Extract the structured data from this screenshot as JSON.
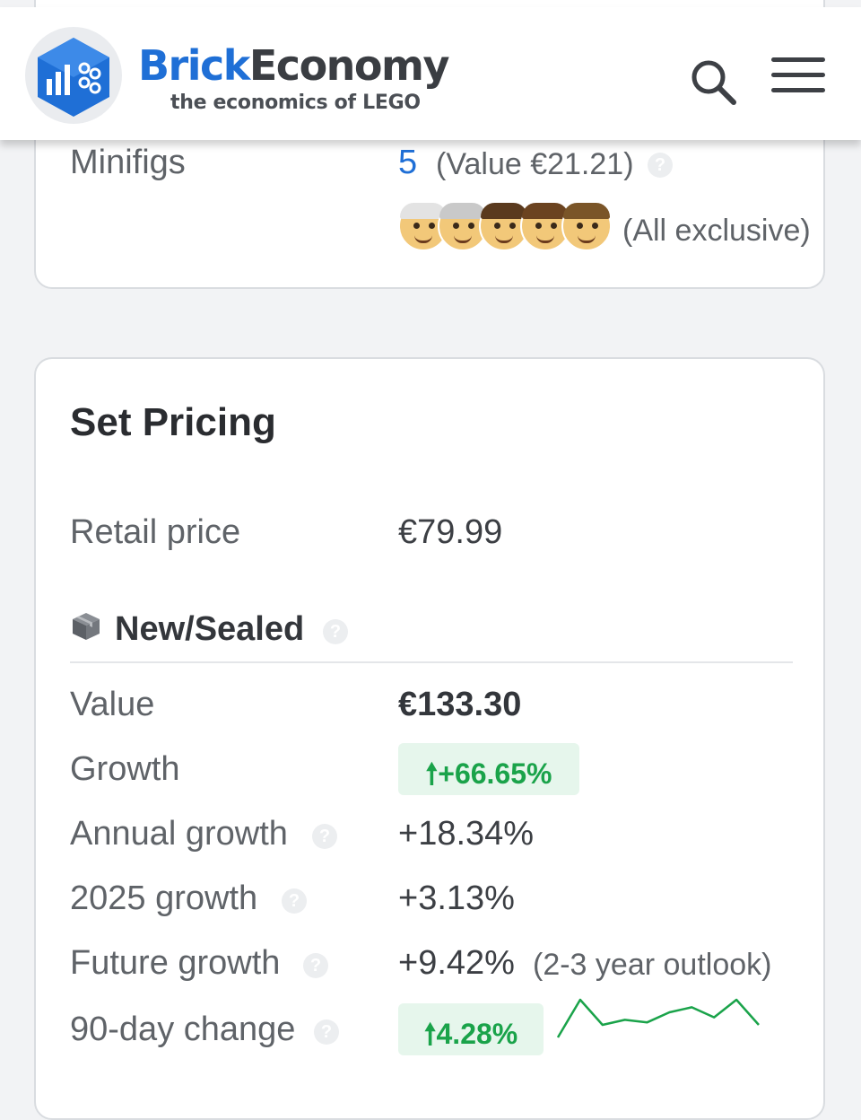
{
  "header": {
    "brand_part1": "Brick",
    "brand_part2": "Economy",
    "tagline": "the economics of LEGO",
    "search_icon": "search-icon",
    "menu_icon": "hamburger-menu-icon",
    "brand_color": "#1f6fd6"
  },
  "minifigs": {
    "label": "Minifigs",
    "count": "5",
    "value_text": "(Value €21.21)",
    "exclusive_text": "(All exclusive)",
    "faces": [
      "minifig-1",
      "minifig-2",
      "minifig-3",
      "minifig-4",
      "minifig-5"
    ]
  },
  "pricing": {
    "title": "Set Pricing",
    "retail_label": "Retail price",
    "retail_value": "€79.99",
    "section_label": "New/Sealed",
    "rows": {
      "value_label": "Value",
      "value": "€133.30",
      "growth_label": "Growth",
      "growth": "+66.65%",
      "annual_label": "Annual growth",
      "annual": "+18.34%",
      "y2025_label": "2025 growth",
      "y2025": "+3.13%",
      "future_label": "Future growth",
      "future": "+9.42%",
      "future_note": "(2-3 year outlook)",
      "change90_label": "90-day change",
      "change90": "4.28%"
    },
    "positive_color": "#1aa34a",
    "sparkline_trend": [
      0,
      3,
      1,
      1.4,
      1.2,
      2,
      2.4,
      1.6,
      3,
      1
    ]
  }
}
